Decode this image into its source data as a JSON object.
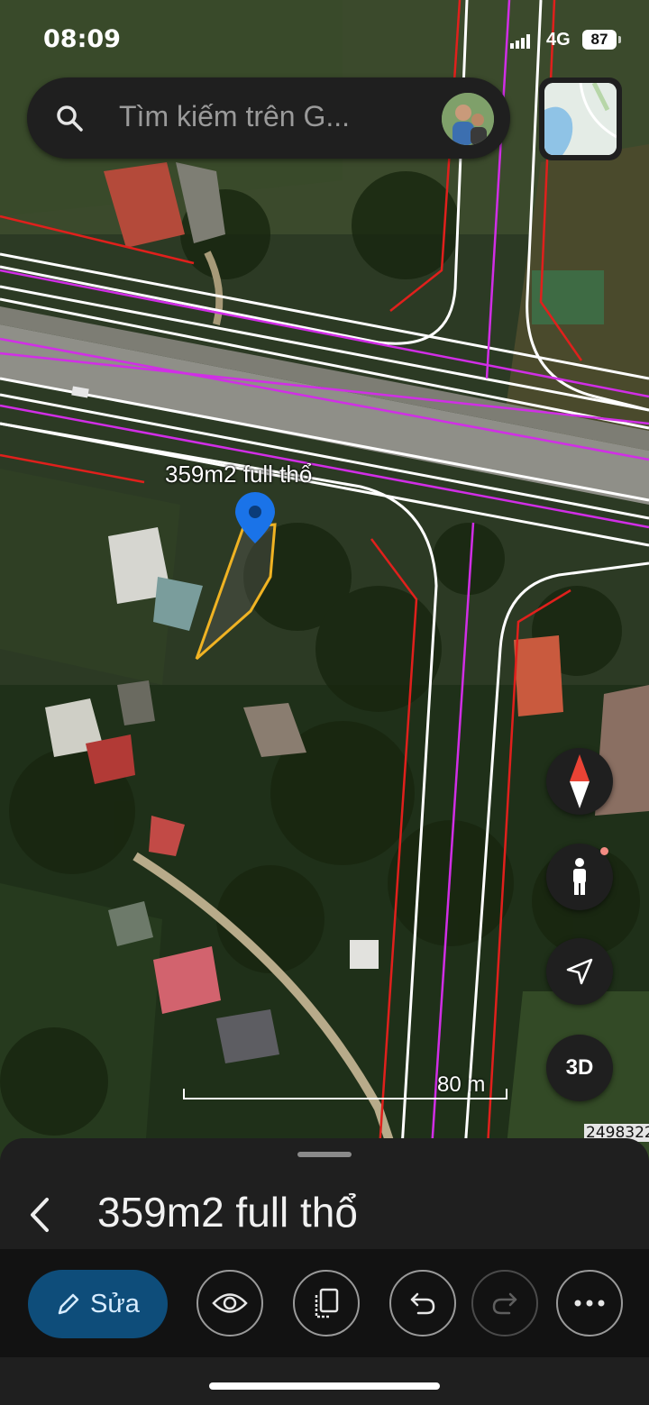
{
  "status_bar": {
    "time": "08:09",
    "network": "4G",
    "battery": "87"
  },
  "search": {
    "placeholder": "Tìm kiếm trên G..."
  },
  "map": {
    "placemark_label": "359m2 full thổ",
    "scale_label": "80 m",
    "coordinate_text": "2498322",
    "colors": {
      "road_lines": "#ffffff",
      "parcel_lines": "#e0201c",
      "boundary_lines": "#d12ee6",
      "polygon": "#f0b323",
      "pin": "#1a73e8"
    }
  },
  "controls": {
    "three_d_label": "3D"
  },
  "sheet": {
    "title": "359m2 full thổ",
    "edit_label": "Sửa"
  },
  "colors": {
    "accent": "#0e4d7a",
    "surface": "#1f1f1f"
  }
}
